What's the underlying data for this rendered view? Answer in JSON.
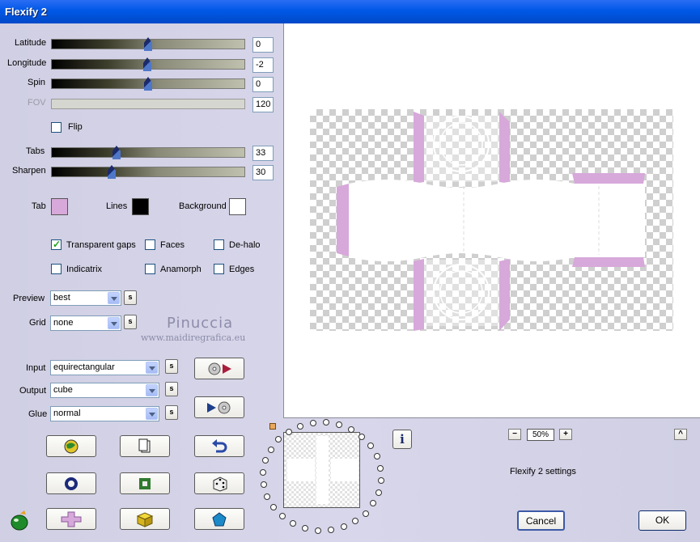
{
  "window": {
    "title": "Flexify 2"
  },
  "sliders": [
    {
      "label": "Latitude",
      "value": "0",
      "position": 0.5
    },
    {
      "label": "Longitude",
      "value": "-2",
      "position": 0.495
    },
    {
      "label": "Spin",
      "value": "0",
      "position": 0.5
    },
    {
      "label": "FOV",
      "value": "120",
      "disabled": true
    },
    {
      "label": "Tabs",
      "value": "33",
      "position": 0.33
    },
    {
      "label": "Sharpen",
      "value": "30",
      "position": 0.3
    }
  ],
  "flip": {
    "label": "Flip",
    "checked": false
  },
  "colors": {
    "tab": {
      "label": "Tab",
      "color": "#d7a8da"
    },
    "lines": {
      "label": "Lines",
      "color": "#000000"
    },
    "background": {
      "label": "Background",
      "color": "#ffffff"
    }
  },
  "options": [
    {
      "label": "Transparent gaps",
      "checked": true
    },
    {
      "label": "Faces",
      "checked": false
    },
    {
      "label": "De-halo",
      "checked": false
    },
    {
      "label": "Indicatrix",
      "checked": false
    },
    {
      "label": "Anamorph",
      "checked": false
    },
    {
      "label": "Edges",
      "checked": false
    }
  ],
  "preview_select": {
    "label": "Preview",
    "value": "best",
    "s": "s"
  },
  "grid_select": {
    "label": "Grid",
    "value": "none",
    "s": "s"
  },
  "input_select": {
    "label": "Input",
    "value": "equirectangular",
    "s": "s"
  },
  "output_select": {
    "label": "Output",
    "value": "cube",
    "s": "s"
  },
  "glue_select": {
    "label": "Glue",
    "value": "normal",
    "s": "s"
  },
  "watermark": {
    "name": "Pinuccia",
    "site": "www.maidiregrafica.eu"
  },
  "zoom": {
    "minus": "−",
    "value": "50%",
    "plus": "+"
  },
  "info": {
    "icon": "i"
  },
  "settings_name": "Flexify 2 settings",
  "scroll_up": "^",
  "buttons": {
    "cancel": "Cancel",
    "ok": "OK"
  },
  "accent": "#d7a8da"
}
